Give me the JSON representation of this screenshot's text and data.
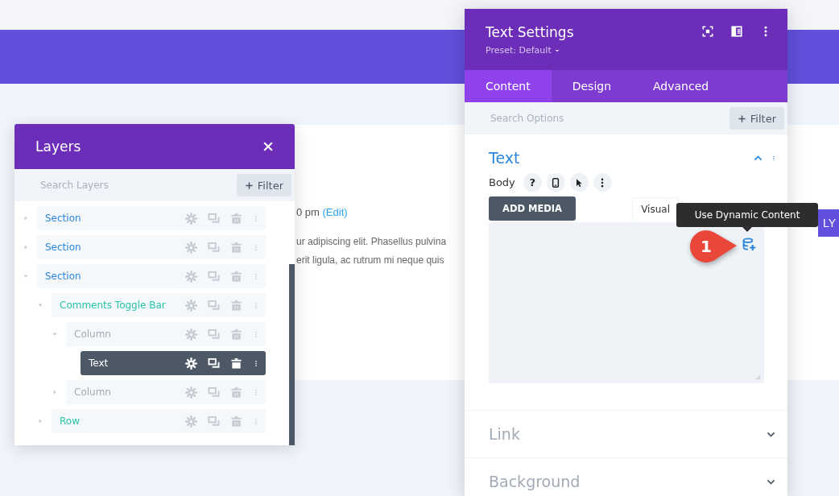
{
  "page": {
    "meta_text": "0 pm",
    "edit_link": "(Edit)",
    "paragraph_lines": [
      "ur adipiscing elit. Phasellus pulvina",
      "erit ligula, ac rutrum mi neque quis"
    ],
    "reply_button": "LY"
  },
  "layers_panel": {
    "title": "Layers",
    "search": {
      "placeholder": "Search Layers"
    },
    "filter_button": "Filter",
    "layers": [
      {
        "label": "Section",
        "kind": "section",
        "expanded": false,
        "selected": false
      },
      {
        "label": "Section",
        "kind": "section",
        "expanded": false,
        "selected": false
      },
      {
        "label": "Section",
        "kind": "section",
        "expanded": true,
        "selected": false,
        "children": [
          {
            "label": "Comments Toggle Bar",
            "kind": "row",
            "expanded": true,
            "selected": false,
            "children": [
              {
                "label": "Column",
                "kind": "column",
                "expanded": true,
                "selected": false,
                "children": [
                  {
                    "label": "Text",
                    "kind": "module",
                    "selected": true
                  }
                ]
              },
              {
                "label": "Column",
                "kind": "column",
                "expanded": false,
                "selected": false
              }
            ]
          },
          {
            "label": "Row",
            "kind": "row",
            "expanded": false,
            "selected": false
          }
        ]
      }
    ]
  },
  "settings_panel": {
    "title": "Text Settings",
    "preset": "Preset: Default",
    "tabs": [
      {
        "label": "Content",
        "selected": true
      },
      {
        "label": "Design",
        "selected": false
      },
      {
        "label": "Advanced",
        "selected": false
      }
    ],
    "search": {
      "placeholder": "Search Options"
    },
    "filter_button": "Filter",
    "sections": [
      {
        "title": "Text",
        "expanded": true
      },
      {
        "title": "Link",
        "expanded": false
      },
      {
        "title": "Background",
        "expanded": false
      }
    ],
    "body_label": "Body",
    "help_button": "?",
    "add_media_button": "ADD MEDIA",
    "editor_tabs": [
      {
        "label": "Visual",
        "selected": true
      }
    ],
    "tooltip": "Use Dynamic Content",
    "callout": "1"
  }
}
